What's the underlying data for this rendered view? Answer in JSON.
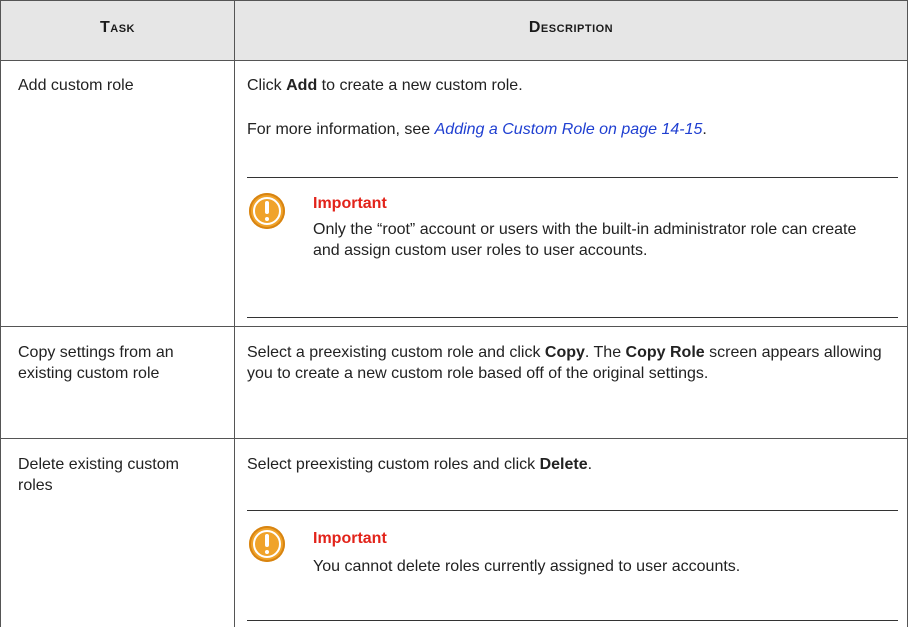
{
  "headers": {
    "task": "Task",
    "description": "Description"
  },
  "rows": [
    {
      "task": "Add custom role",
      "desc_line1_pre": "Click ",
      "desc_line1_bold": "Add",
      "desc_line1_post": " to create a new custom role.",
      "desc_line2_pre": "For more information, see ",
      "desc_line2_link": "Adding a Custom Role on page 14-15",
      "desc_line2_post": ".",
      "note_title": "Important",
      "note_text": "Only the “root” account or users with the built-in administrator role can create and assign custom user roles to user accounts."
    },
    {
      "task": "Copy settings from an existing custom role",
      "d_pre": "Select a preexisting custom role and click ",
      "d_b1": "Copy",
      "d_mid": ". The ",
      "d_b2": "Copy Role",
      "d_post": " screen appears allowing you to create a new custom role based off of the original settings."
    },
    {
      "task": "Delete existing custom roles",
      "d_pre": "Select preexisting custom roles and click ",
      "d_b1": "Delete",
      "d_post": ".",
      "note_title": "Important",
      "note_text": "You cannot delete roles currently assigned to user accounts."
    }
  ],
  "colors": {
    "header_bg": "#e6e6e6",
    "important_red": "#e2231a",
    "link_blue": "#1f3fd1",
    "icon_orange": "#f0a32a"
  },
  "icons": [
    "important-icon"
  ]
}
